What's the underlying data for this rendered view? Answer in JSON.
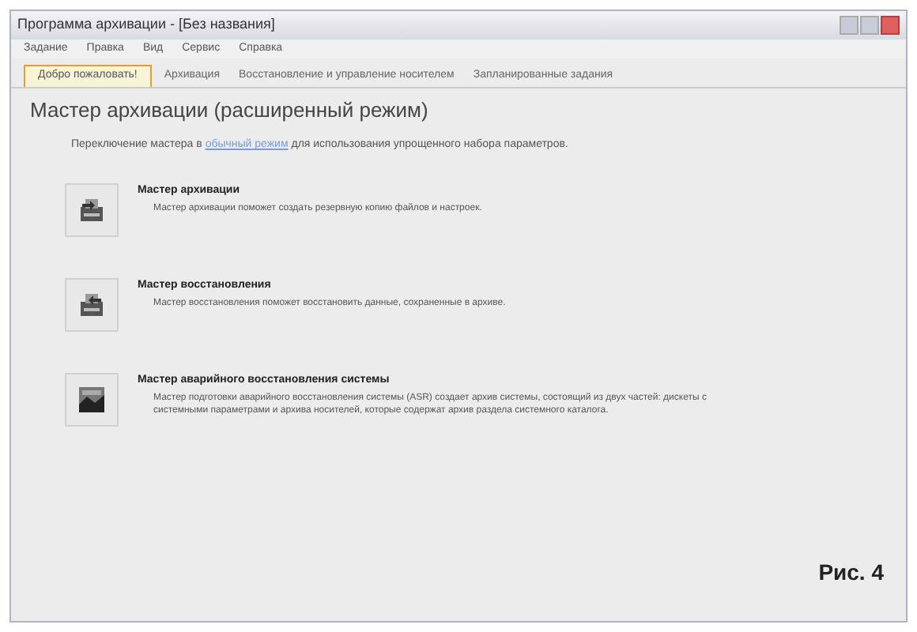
{
  "window": {
    "title": "Программа архивации - [Без названия]"
  },
  "menu": [
    "Задание",
    "Правка",
    "Вид",
    "Сервис",
    "Справка"
  ],
  "tabs": [
    {
      "label": "Добро пожаловать!",
      "selected": true
    },
    {
      "label": "Архивация",
      "selected": false
    },
    {
      "label": "Восстановление и управление носителем",
      "selected": false
    },
    {
      "label": "Запланированные задания",
      "selected": false
    }
  ],
  "heading": "Мастер архивации (расширенный режим)",
  "switch_line": {
    "before": "Переключение мастера в",
    "link": "обычный режим",
    "after": "для использования упрощенного набора параметров."
  },
  "wizards": [
    {
      "kind": "backup",
      "title": "Мастер архивации",
      "description": "Мастер архивации поможет создать резервную копию файлов и настроек."
    },
    {
      "kind": "restore",
      "title": "Мастер восстановления",
      "description": "Мастер восстановления поможет восстановить данные, сохраненные в архиве."
    },
    {
      "kind": "asr",
      "title": "Мастер аварийного восстановления системы",
      "description": "Мастер подготовки аварийного восстановления системы (ASR) создает архив системы, состоящий из двух частей: дискеты с системными параметрами и архива носителей, которые содержат архив раздела системного каталога."
    }
  ],
  "caption": "Рис. 4"
}
